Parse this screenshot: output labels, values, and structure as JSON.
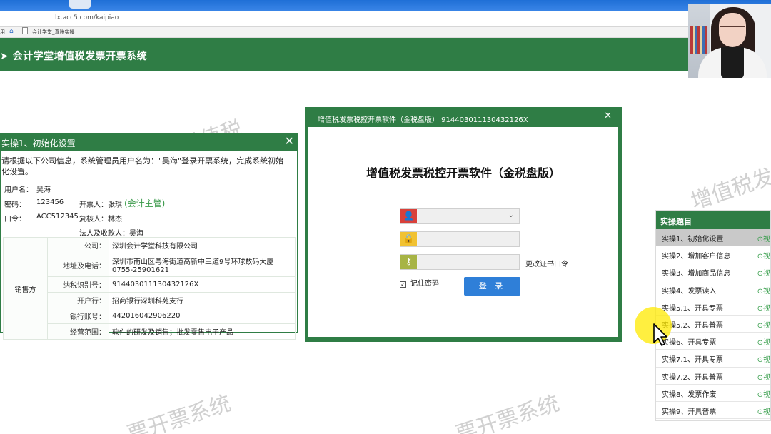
{
  "browser": {
    "url": "lx.acc5.com/kaipiao",
    "bookmarks": {
      "use_label": "用",
      "home_icon": "home-icon",
      "page_tab": "会计学堂_真账实操"
    }
  },
  "app": {
    "title": "会计学堂增值税发票开票系统",
    "header_color": "#2f7d45"
  },
  "watermarks": [
    "增值税",
    "增值税发",
    "票开票系统",
    "票开票系统"
  ],
  "task_panel": {
    "title": "实操1、初始化设置",
    "intro": "请根据以下公司信息，系统管理员用户名为：\"吴海\"登录开票系统，完成系统初始化设置。",
    "user_label": "用户名：",
    "user_value": "吴海",
    "pwd_label": "密码：",
    "pwd_value": "123456",
    "drawer_label": "开票人：张琪",
    "drawer_role": "(会计主管)",
    "cmd_label": "口令：",
    "cmd_value": "ACC512345",
    "reviewer_label": "复核人：林杰",
    "legal_label": "法人及收款人：吴海",
    "seller_label": "销售方",
    "rows": [
      {
        "label": "公司：",
        "value": "深圳会计学堂科技有限公司"
      },
      {
        "label": "地址及电话：",
        "value": "深圳市南山区粤海街道高新中三道9号环球数码大厦 0755-25901621"
      },
      {
        "label": "纳税识别号：",
        "value": "914403011130432126X"
      },
      {
        "label": "开户行：",
        "value": "招商银行深圳科苑支行"
      },
      {
        "label": "银行账号：",
        "value": "442016042906220"
      },
      {
        "label": "经营范围：",
        "value": "软件的研发及销售；批发零售电子产品"
      }
    ]
  },
  "login_dialog": {
    "title": "增值税发票税控开票软件（金税盘版） 914403011130432126X",
    "heading": "增值税发票税控开票软件（金税盘版）",
    "change_cert": "更改证书口令",
    "remember": "记住密码",
    "remember_checked": true,
    "login_button": "登 录",
    "icons": {
      "user": "user-icon",
      "password": "lock-icon",
      "cert": "key-icon"
    }
  },
  "exercise_list": {
    "title": "实操题目",
    "view_label": "⊙视",
    "items": [
      "实操1、初始化设置",
      "实操2、增加客户信息",
      "实操3、增加商品信息",
      "实操4、发票读入",
      "实操5.1、开具专票",
      "实操5.2、开具普票",
      "实操6、开具专票",
      "实操7.1、开具专票",
      "实操7.2、开具普票",
      "实操8、发票作废",
      "实操9、开具普票"
    ],
    "active_index": 0
  }
}
